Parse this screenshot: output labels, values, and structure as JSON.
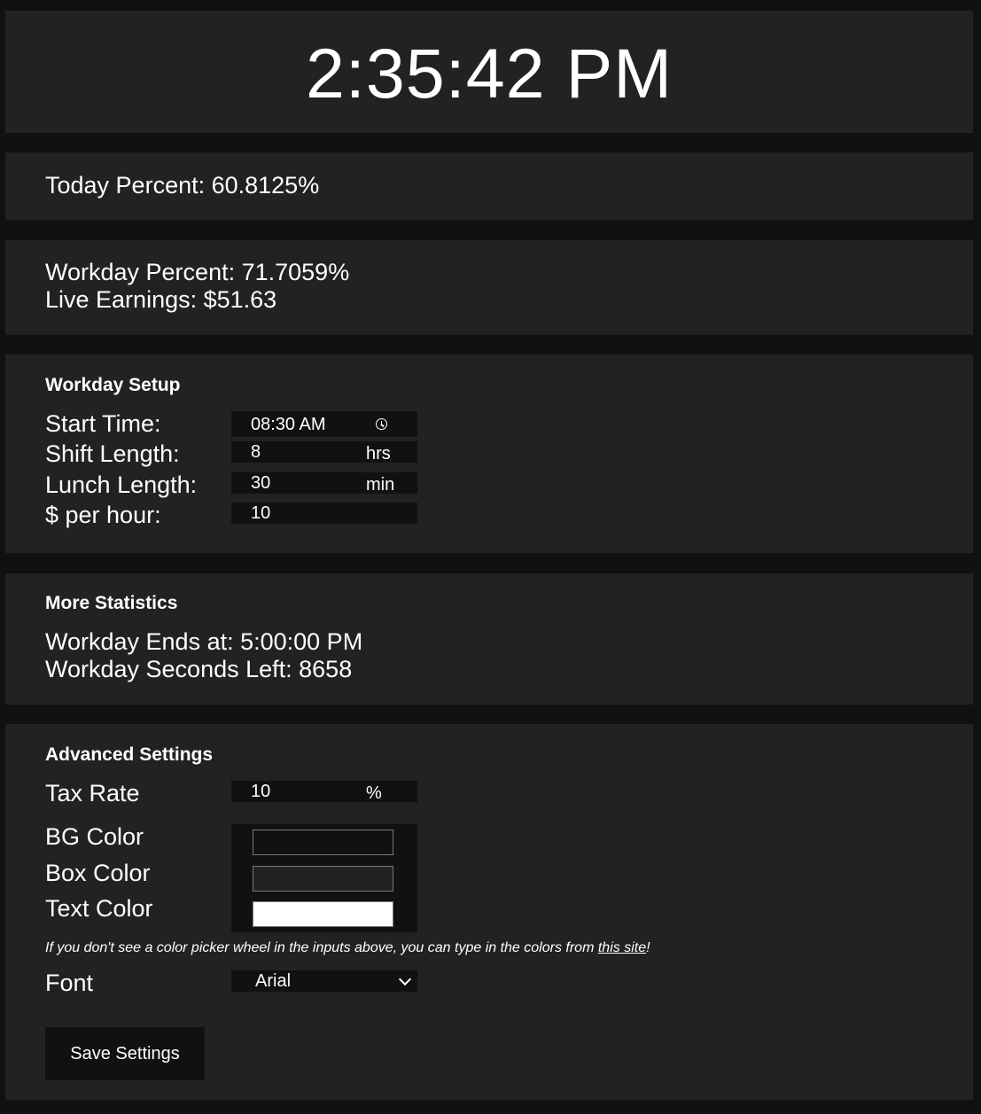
{
  "clock": {
    "time": "2:35:42 PM"
  },
  "today": {
    "percent_text": "Today Percent: 60.8125%"
  },
  "workday": {
    "percent_text": "Workday Percent: 71.7059%",
    "earnings_text": "Live Earnings: $51.63"
  },
  "setup": {
    "heading": "Workday Setup",
    "start_time_label": "Start Time:",
    "start_time_value": "08:30  AM",
    "shift_length_label": "Shift Length:",
    "shift_length_value": "8",
    "shift_length_unit": "hrs",
    "lunch_length_label": "Lunch Length:",
    "lunch_length_value": "30",
    "lunch_length_unit": "min",
    "rate_label": "$ per hour:",
    "rate_value": "10"
  },
  "stats": {
    "heading": "More Statistics",
    "ends_at_text": "Workday Ends at: 5:00:00 PM",
    "seconds_left_text": "Workday Seconds Left: 8658"
  },
  "advanced": {
    "heading": "Advanced Settings",
    "tax_label": "Tax Rate",
    "tax_value": "10",
    "tax_unit": "%",
    "bg_color_label": "BG Color",
    "box_color_label": "Box Color",
    "text_color_label": "Text Color",
    "note_prefix": "If you don't see a color picker wheel in the inputs above, you can type in the colors from ",
    "note_link": "this site",
    "note_suffix": "!",
    "font_label": "Font",
    "font_value": "Arial",
    "save_label": "Save Settings"
  },
  "colors": {
    "page_bg": "#111111",
    "box_bg": "#222222",
    "text": "#ffffff",
    "bg_color_value": "#111111",
    "box_color_value": "#222222",
    "text_color_value": "#ffffff"
  }
}
